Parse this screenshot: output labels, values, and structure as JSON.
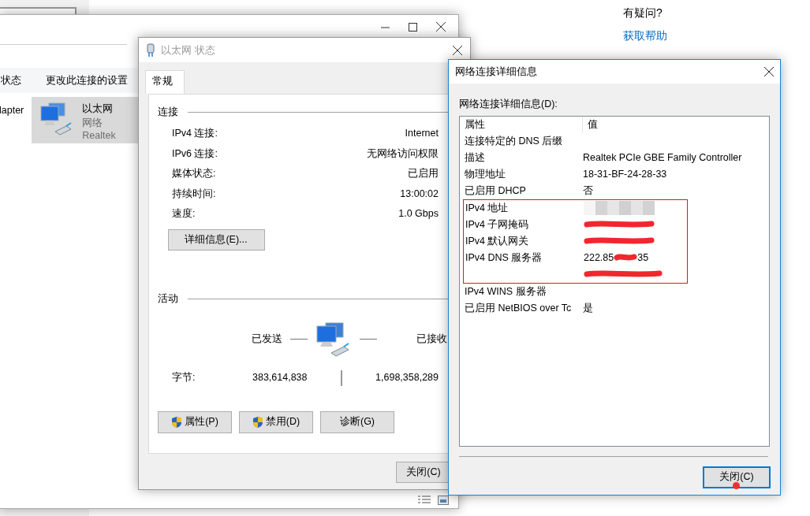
{
  "settings": {
    "help_heading": "有疑问?",
    "help_link": "获取帮助"
  },
  "connections_window": {
    "toolbar": [
      "状态",
      "更改此连接的设置"
    ],
    "items": [
      {
        "name": "lapter",
        "selected": false
      },
      {
        "name": "以太网",
        "type": "网络",
        "device": "Realtek",
        "selected": true
      }
    ]
  },
  "status_window": {
    "title": "以太网 状态",
    "tabs": [
      {
        "label": "常规",
        "selected": true
      }
    ],
    "connection": {
      "heading": "连接",
      "rows": [
        {
          "label": "IPv4 连接:",
          "value": "Internet"
        },
        {
          "label": "IPv6 连接:",
          "value": "无网络访问权限"
        },
        {
          "label": "媒体状态:",
          "value": "已启用"
        },
        {
          "label": "持续时间:",
          "value": "13:00:02"
        },
        {
          "label": "速度:",
          "value": "1.0 Gbps"
        }
      ]
    },
    "details_button": "详细信息(E)...",
    "activity": {
      "heading": "活动",
      "sent_label": "已发送",
      "received_label": "已接收",
      "bytes_label": "字节:",
      "sent": "383,614,838",
      "received": "1,698,358,289"
    },
    "buttons": [
      {
        "label": "属性(P)",
        "shield": true
      },
      {
        "label": "禁用(D)",
        "shield": true
      },
      {
        "label": "诊断(G)",
        "shield": false
      }
    ],
    "close_button": "关闭(C)"
  },
  "details_window": {
    "title": "网络连接详细信息",
    "list_label": "网络连接详细信息(D):",
    "columns": [
      "属性",
      "值"
    ],
    "rows": [
      {
        "kind": "plain",
        "property": "连接特定的 DNS 后缀"
      },
      {
        "kind": "plain",
        "property": "描述",
        "value": "Realtek PCIe GBE Family Controller"
      },
      {
        "kind": "plain",
        "property": "物理地址",
        "value": "18-31-BF-24-28-33"
      },
      {
        "kind": "plain",
        "property": "已启用 DHCP",
        "value": "否"
      },
      {
        "kind": "highlight_group",
        "rows": [
          {
            "kind": "blurred",
            "property": "IPv4 地址"
          },
          {
            "kind": "scribbled",
            "property": "IPv4 子网掩码"
          },
          {
            "kind": "scribbled",
            "property": "IPv4 默认网关"
          },
          {
            "kind": "partly_scribbled",
            "property": "IPv4 DNS 服务器",
            "value": "222.85",
            "value_end": "35"
          },
          {
            "kind": "scribbled"
          }
        ]
      },
      {
        "kind": "plain",
        "property": "IPv4 WINS 服务器"
      },
      {
        "kind": "plain",
        "property": "已启用 NetBIOS over Tc",
        "value": "是"
      }
    ],
    "close_button": {
      "label": "关闭(C)",
      "focused": true
    }
  }
}
